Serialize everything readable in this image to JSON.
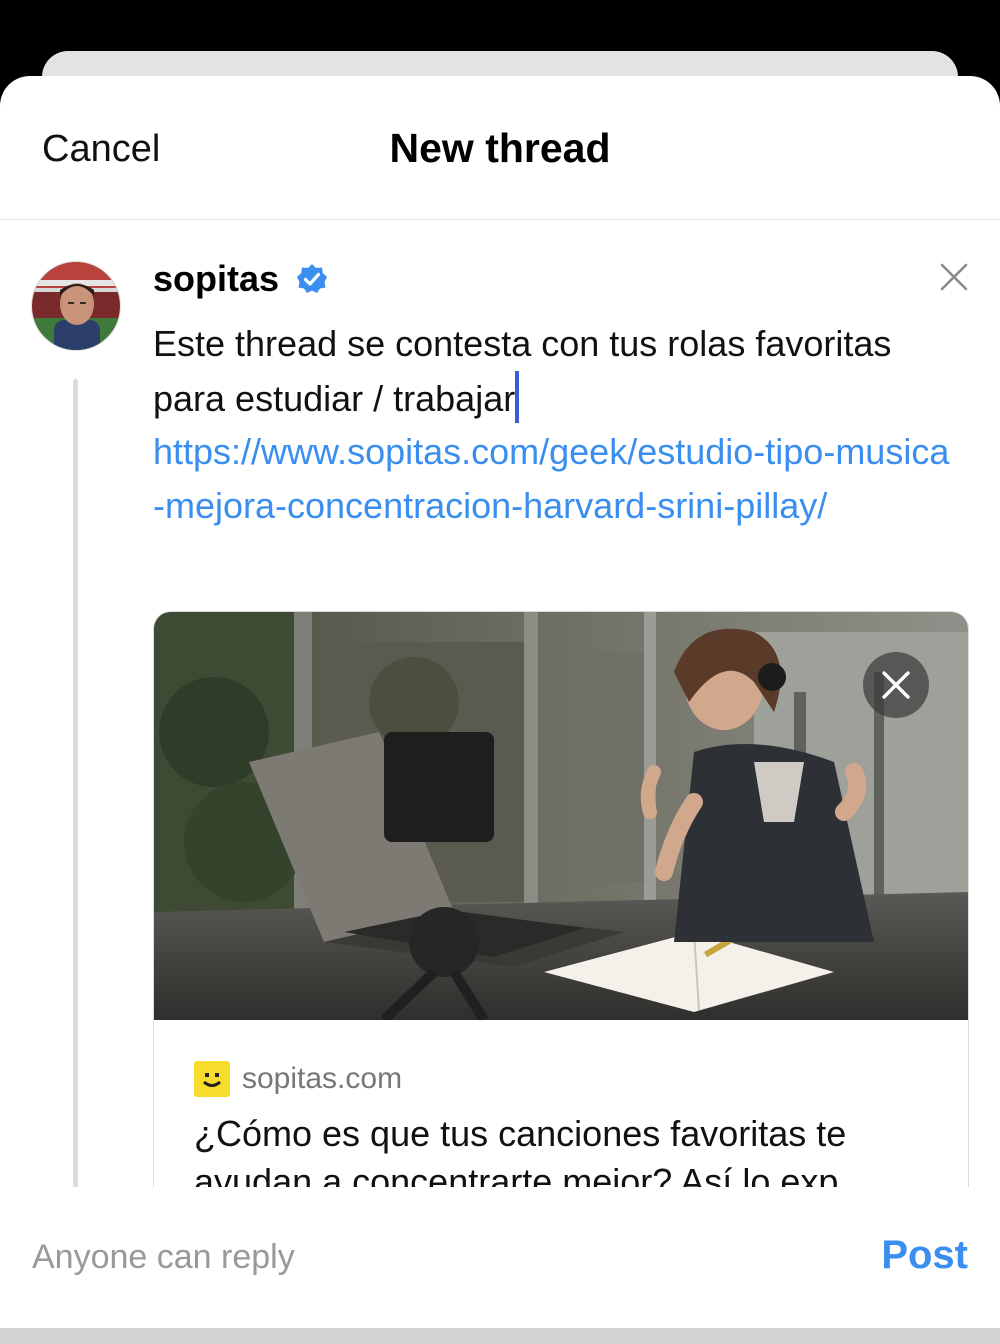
{
  "header": {
    "cancel_label": "Cancel",
    "title": "New thread"
  },
  "post": {
    "username": "sopitas",
    "verified": true,
    "text": "Este thread se contesta con tus rolas favoritas para estudiar / trabajar",
    "link": "https://www.sopitas.com/geek/estudio-tipo-musica-mejora-concentracion-harvard-srini-pillay/"
  },
  "link_card": {
    "domain": "sopitas.com",
    "title": "¿Cómo es que tus canciones favoritas te ayudan a concentrarte mejor? Así lo exp"
  },
  "footer": {
    "reply_scope": "Anyone can reply",
    "post_label": "Post"
  },
  "colors": {
    "accent": "#3a8ef0",
    "verified": "#3a8ef0",
    "thread_line": "#dcdcdc"
  },
  "icons": [
    "verified-badge-icon",
    "close-icon",
    "remove-preview-icon",
    "site-favicon"
  ]
}
